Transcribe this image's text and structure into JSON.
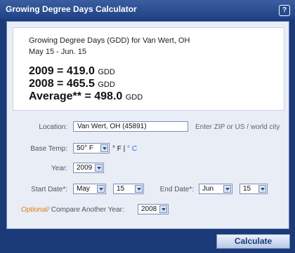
{
  "window": {
    "title": "Growing Degree Days Calculator",
    "help_label": "?"
  },
  "result": {
    "heading": "Growing Degree Days (GDD) for Van Wert, OH",
    "date_range": "May 15 - Jun. 15",
    "lines": [
      {
        "label": "2009 = ",
        "value": "419.0",
        "unit": "GDD"
      },
      {
        "label": "2008 = ",
        "value": "465.5",
        "unit": "GDD"
      },
      {
        "label": "Average** = ",
        "value": "498.0",
        "unit": "GDD"
      }
    ]
  },
  "form": {
    "location_label": "Location:",
    "location_value": "Van Wert, OH (45891)",
    "location_hint": "Enter ZIP or US / world city",
    "base_temp_label": "Base Temp:",
    "base_temp_value": "50° F",
    "unit_f": "° F",
    "unit_sep": " | ",
    "unit_c": "° C",
    "year_label": "Year:",
    "year_value": "2009",
    "start_label": "Start Date*:",
    "start_month": "May",
    "start_day": "15",
    "end_label": "End Date*:",
    "end_month": "Jun",
    "end_day": "15",
    "optional_label": "Optional/",
    "compare_label": " Compare Another Year:",
    "compare_value": "2008"
  },
  "buttons": {
    "calculate": "Calculate"
  },
  "colors": {
    "title_bar": "#1e4185",
    "panel": "#e9edf6",
    "accent_orange": "#e07a10",
    "accent_blue": "#2b6bd6"
  }
}
